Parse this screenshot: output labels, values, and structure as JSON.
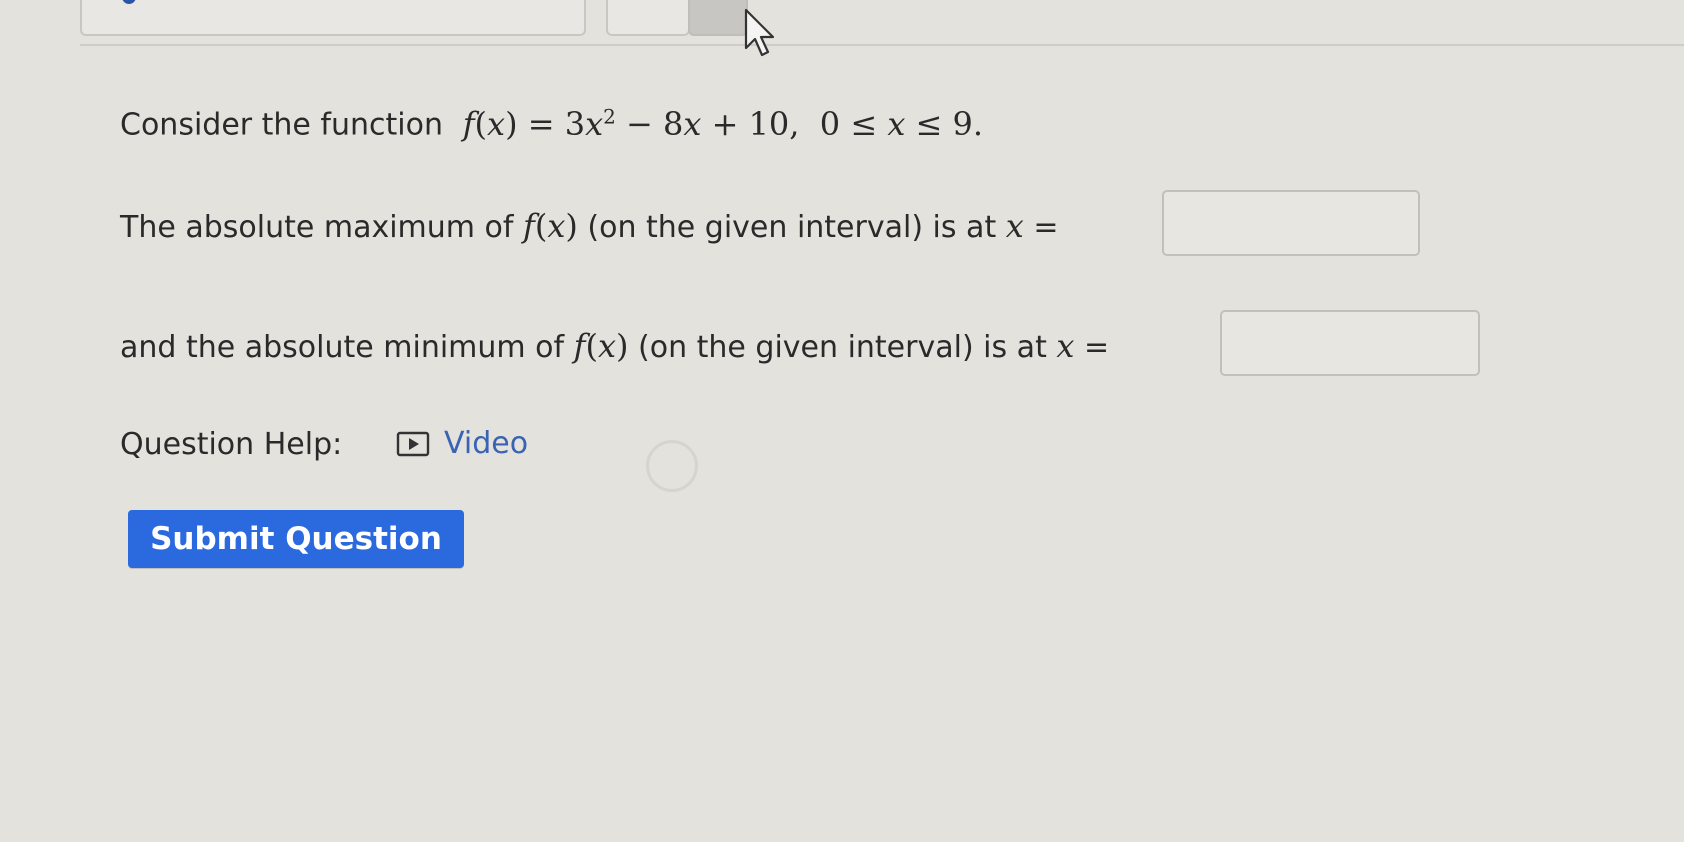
{
  "question": {
    "prompt_prefix": "Consider the function",
    "function_name": "f",
    "variable": "x",
    "equals": "=",
    "expr_coef_a": "3",
    "expr_exponent": "2",
    "expr_rest": " − 8",
    "expr_rest_tail": " + 10,",
    "interval_left": "0 ≤ ",
    "interval_le": " ≤ 9.",
    "max_prefix": "The absolute maximum of",
    "max_suffix": "(on the given interval) is at",
    "min_prefix": "and the absolute minimum of",
    "min_suffix": "(on the given interval) is at",
    "answer_equals": "=",
    "max_answer_value": "",
    "min_answer_value": ""
  },
  "help": {
    "label": "Question Help:",
    "video_label": "Video",
    "video_icon": "play-icon"
  },
  "actions": {
    "submit_label": "Submit Question"
  },
  "colors": {
    "submit_bg": "#2b69de",
    "link": "#3a63b4",
    "page_bg": "#e4e2dd"
  }
}
